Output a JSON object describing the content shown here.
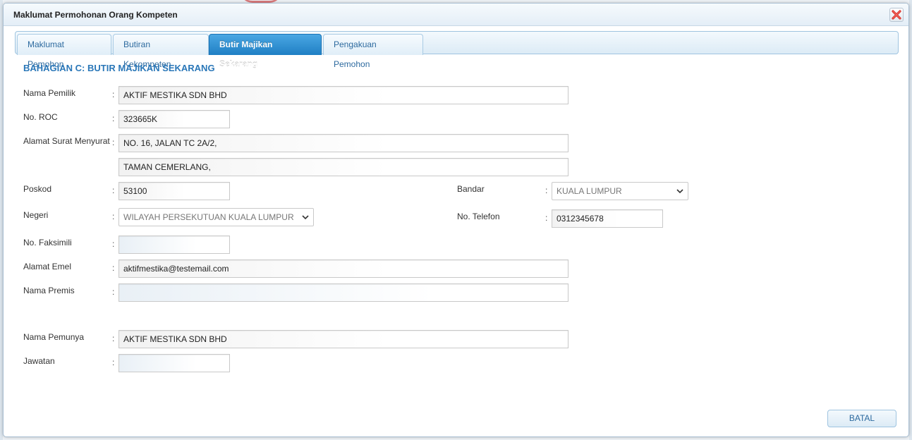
{
  "dialog": {
    "title": "Maklumat Permohonan Orang Kompeten"
  },
  "tabs": [
    {
      "label": "Maklumat Pemohon"
    },
    {
      "label": "Butiran Kekompeten"
    },
    {
      "label": "Butir Majikan Sekarang",
      "active": true
    },
    {
      "label": "Pengakuan Pemohon"
    }
  ],
  "section": {
    "title": "BAHAGIAN C: BUTIR MAJIKAN SEKARANG"
  },
  "colon": ":",
  "form": {
    "nama_pemilik": {
      "label": "Nama Pemilik",
      "value": "AKTIF MESTIKA SDN BHD"
    },
    "no_roc": {
      "label": "No. ROC",
      "value": "323665K"
    },
    "alamat": {
      "label": "Alamat Surat Menyurat",
      "line1": "NO. 16, JALAN TC 2A/2,",
      "line2": "TAMAN CEMERLANG,"
    },
    "poskod": {
      "label": "Poskod",
      "value": "53100"
    },
    "bandar": {
      "label": "Bandar",
      "value": "KUALA LUMPUR"
    },
    "negeri": {
      "label": "Negeri",
      "value": "WILAYAH PERSEKUTUAN KUALA LUMPUR"
    },
    "no_telefon": {
      "label": "No. Telefon",
      "value": "0312345678"
    },
    "no_faksimili": {
      "label": "No. Faksimili",
      "value": ""
    },
    "alamat_emel": {
      "label": "Alamat Emel",
      "value": "aktifmestika@testemail.com"
    },
    "nama_premis": {
      "label": "Nama Premis",
      "value": ""
    },
    "nama_pemunya": {
      "label": "Nama Pemunya",
      "value": "AKTIF MESTIKA SDN BHD"
    },
    "jawatan": {
      "label": "Jawatan",
      "value": ""
    }
  },
  "buttons": {
    "batal": "BATAL"
  },
  "colors": {
    "accent": "#2a77b8",
    "active_tab": "#1f7fc4",
    "close_red": "#d9302a"
  }
}
